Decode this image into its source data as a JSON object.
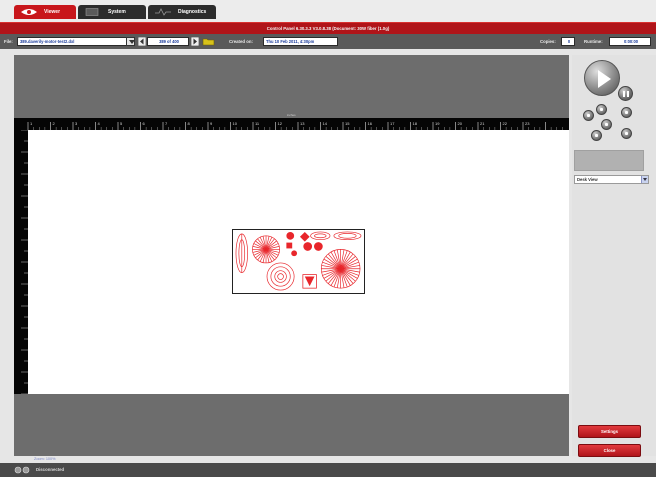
{
  "tabs": [
    {
      "label": "Viewer"
    },
    {
      "label": "System"
    },
    {
      "label": "Diagnostics"
    }
  ],
  "title": "Control Panel  6.30.3.3   V3.0.8.38 (Document: 30W fiber (1.0g)",
  "infobar": {
    "file_label": "File:",
    "file_value": "389.daverily-motor-test2.dxl",
    "page_value": "389 of 400",
    "created_label": "Created on:",
    "created_value": "Thu 10 Feb 2011,  4:30pm",
    "copies_label": "Copies:",
    "copies_value": "0",
    "runtime_label": "Runtime:",
    "runtime_value": "0:00:00"
  },
  "ruler": {
    "top_ticks": [
      "1",
      "2",
      "3",
      "4",
      "5",
      "6",
      "7",
      "8",
      "9",
      "10",
      "11",
      "12",
      "13",
      "14",
      "15",
      "16",
      "17",
      "18",
      "19",
      "20",
      "21",
      "22",
      "23"
    ],
    "top_mark": "inches"
  },
  "zoom_label": "Zoom: 100%",
  "right_panel": {
    "view_select": "Desk View",
    "settings_label": "Settings",
    "close_label": "Close"
  },
  "status": {
    "connection": "Disconnected"
  },
  "colors": {
    "accent_red": "#c8161b",
    "title_red": "#b01419",
    "design_red": "#e8262b",
    "field_text": "#1a3b9a"
  }
}
